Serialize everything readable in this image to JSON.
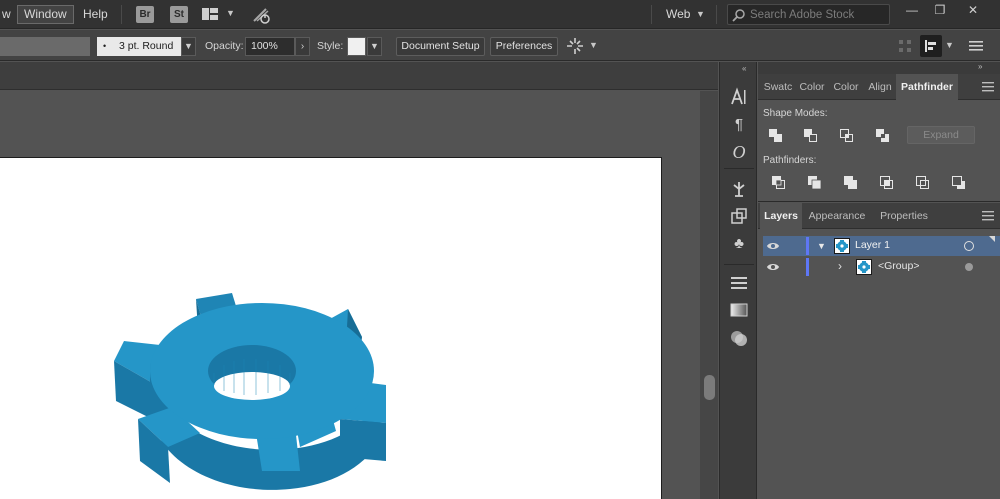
{
  "menubar": {
    "items": [
      "w",
      "Window",
      "Help"
    ],
    "bridge": "Br",
    "stock": "St",
    "workspace": "Web",
    "search_placeholder": "Search Adobe Stock",
    "window_min": "—",
    "window_restore": "❐",
    "window_close": "✕"
  },
  "controlbar": {
    "stroke_profile": "3 pt. Round",
    "stroke_dot": "•",
    "opacity_label": "Opacity:",
    "opacity_value": "100%",
    "style_label": "Style:",
    "document_setup": "Document Setup",
    "preferences": "Preferences"
  },
  "panel_top": {
    "tabs": [
      "Swatc",
      "Color",
      "Color",
      "Align",
      "Pathfinder"
    ],
    "shape_modes_label": "Shape Modes:",
    "pathfinders_label": "Pathfinders:",
    "expand_label": "Expand"
  },
  "panel_layers": {
    "tabs": [
      "Layers",
      "Appearance",
      "Properties"
    ],
    "rows": [
      {
        "name": "Layer 1"
      },
      {
        "name": "<Group>"
      }
    ]
  },
  "colors": {
    "gear_top": "#2596c8",
    "gear_side": "#1a78a6",
    "layer_selected": "#4e6a8f",
    "layer_color": "#5e77f6"
  },
  "icons": {
    "strip": [
      "type-icon",
      "paragraph-icon",
      "opentype-icon",
      "puppet-warp-icon",
      "transform-icon",
      "symbols-icon",
      "stroke-icon",
      "gradient-icon",
      "transparency-icon"
    ]
  }
}
